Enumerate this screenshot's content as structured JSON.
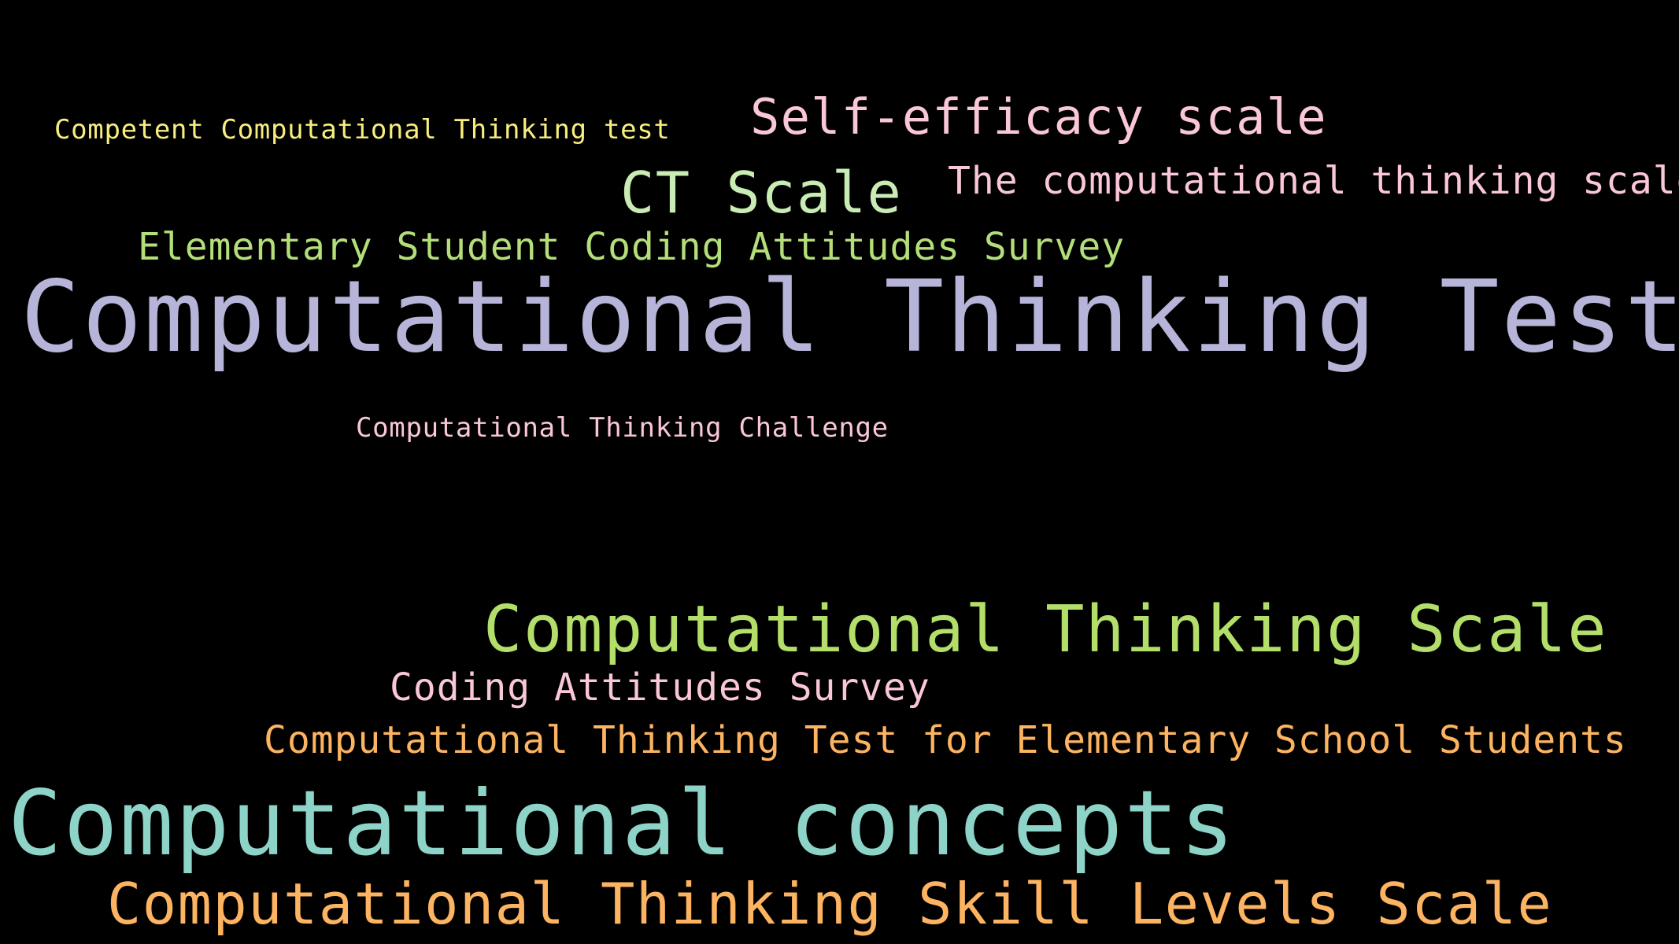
{
  "background_color": "#000000",
  "words": [
    {
      "text": "Competent Computational Thinking test",
      "color": "#f7ee7f"
    },
    {
      "text": "Self-efficacy scale",
      "color": "#f9c6da"
    },
    {
      "text": "CT Scale",
      "color": "#c9ecb4"
    },
    {
      "text": "The computational thinking scale",
      "color": "#f9c6da"
    },
    {
      "text": "Elementary Student Coding Attitudes Survey",
      "color": "#b3de7a"
    },
    {
      "text": "Computational Thinking Test",
      "color": "#b7b4d9"
    },
    {
      "text": "Computational Thinking Challenge",
      "color": "#f9c6da"
    },
    {
      "text": "Computational Thinking Scale",
      "color": "#b3de69"
    },
    {
      "text": "Coding Attitudes Survey",
      "color": "#f9c6da"
    },
    {
      "text": "Computational Thinking Test for Elementary School Students",
      "color": "#fdb462"
    },
    {
      "text": "Computational concepts",
      "color": "#8dd3c7"
    },
    {
      "text": "Computational Thinking Skill Levels Scale",
      "color": "#fdb462"
    }
  ]
}
